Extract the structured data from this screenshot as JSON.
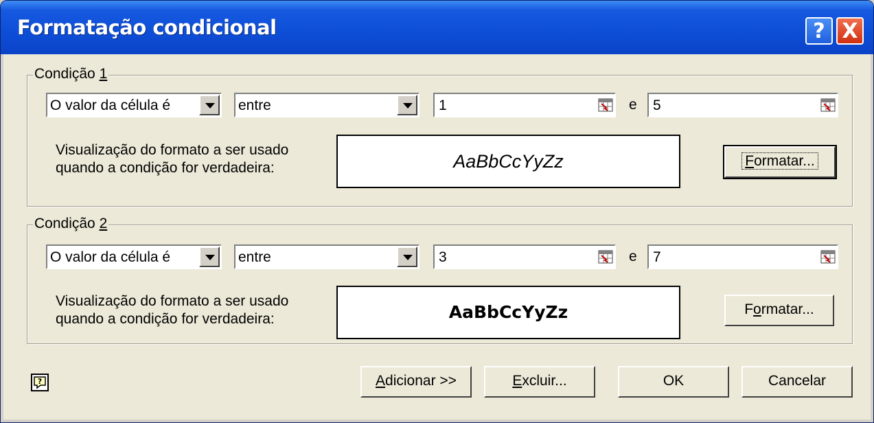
{
  "window": {
    "title": "Formatação condicional"
  },
  "titlebar": {
    "help_label": "?",
    "close_label": "X"
  },
  "condition1": {
    "legend_prefix": "Condição ",
    "legend_key": "1",
    "operand_select": "O valor da célula é",
    "operator_select": "entre",
    "value1": "1",
    "and_label": "e",
    "value2": "5",
    "desc_line1": "Visualização do formato a ser usado",
    "desc_line2": "quando a condição for verdadeira:",
    "preview": "AaBbCcYyZz",
    "format_button_key": "F",
    "format_button_rest": "ormatar..."
  },
  "condition2": {
    "legend_prefix": "Condição ",
    "legend_key": "2",
    "operand_select": "O valor da célula é",
    "operator_select": "entre",
    "value1": "3",
    "and_label": "e",
    "value2": "7",
    "desc_line1": "Visualização do formato a ser usado",
    "desc_line2": "quando a condição for verdadeira:",
    "preview": "AaBbCcYyZz",
    "format_button_pre": "F",
    "format_button_key": "o",
    "format_button_rest": "rmatar..."
  },
  "footer": {
    "add_key": "A",
    "add_rest": "dicionar >>",
    "delete_key": "E",
    "delete_rest": "xcluir...",
    "ok_label": "OK",
    "cancel_label": "Cancelar"
  }
}
